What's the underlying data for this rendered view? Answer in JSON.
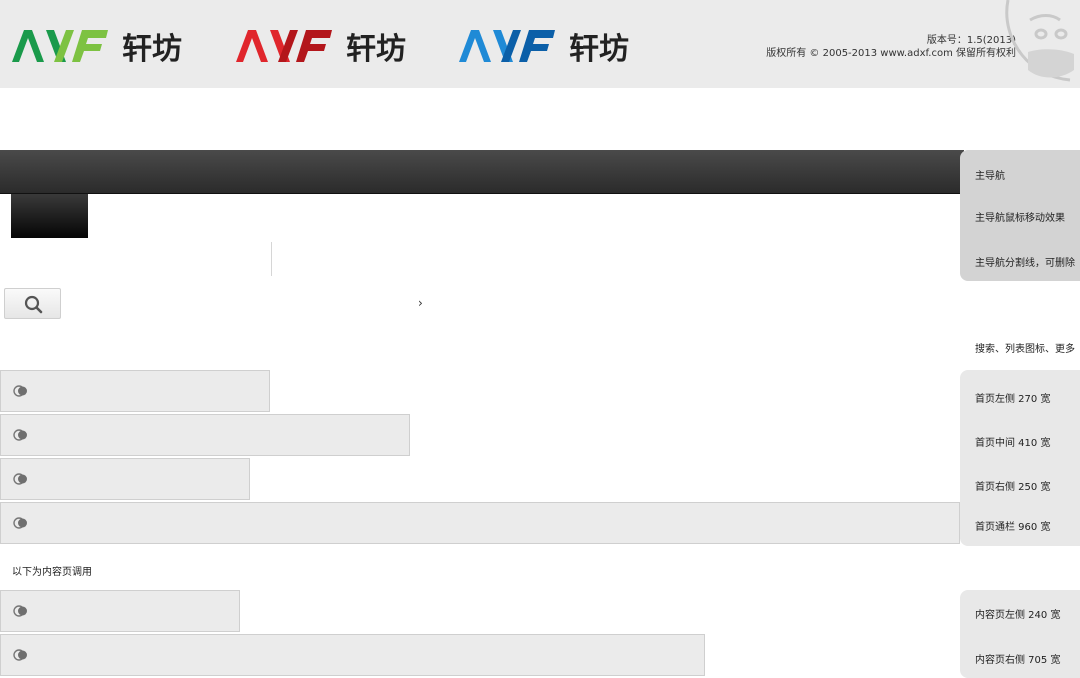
{
  "header": {
    "logos": [
      {
        "latin": "ADXF",
        "cn": "轩坊",
        "colors": [
          "#1a9a4b",
          "#7dc242"
        ]
      },
      {
        "latin": "ADXF",
        "cn": "轩坊",
        "colors": [
          "#e0262c",
          "#b3161b"
        ]
      },
      {
        "latin": "ADXF",
        "cn": "轩坊",
        "colors": [
          "#1f8ad6",
          "#0b5fa8"
        ]
      }
    ],
    "version": "版本号：1.5(2013)",
    "copyright": "版权所有 © 2005-2013 www.adxf.com 保留所有权利"
  },
  "search": {
    "icon": "search-icon",
    "more_glyph": "›"
  },
  "side": {
    "main_nav": "主导航",
    "main_nav_hover": "主导航鼠标移动效果",
    "main_nav_divider": "主导航分割线，可删除",
    "search_icons_more": "搜索、列表图标、更多",
    "home_left": "首页左侧 270 宽",
    "home_middle": "首页中间 410 宽",
    "home_right": "首页右侧 250 宽",
    "home_full": "首页通栏 960 宽",
    "content_left": "内容页左侧 240 宽",
    "content_right": "内容页右侧 705 宽"
  },
  "note": "以下为内容页调用",
  "colors": {
    "bar_bg": "#ebebeb",
    "nav_dark": "#2b2b2b",
    "side_bg": "#e8e8e8"
  }
}
